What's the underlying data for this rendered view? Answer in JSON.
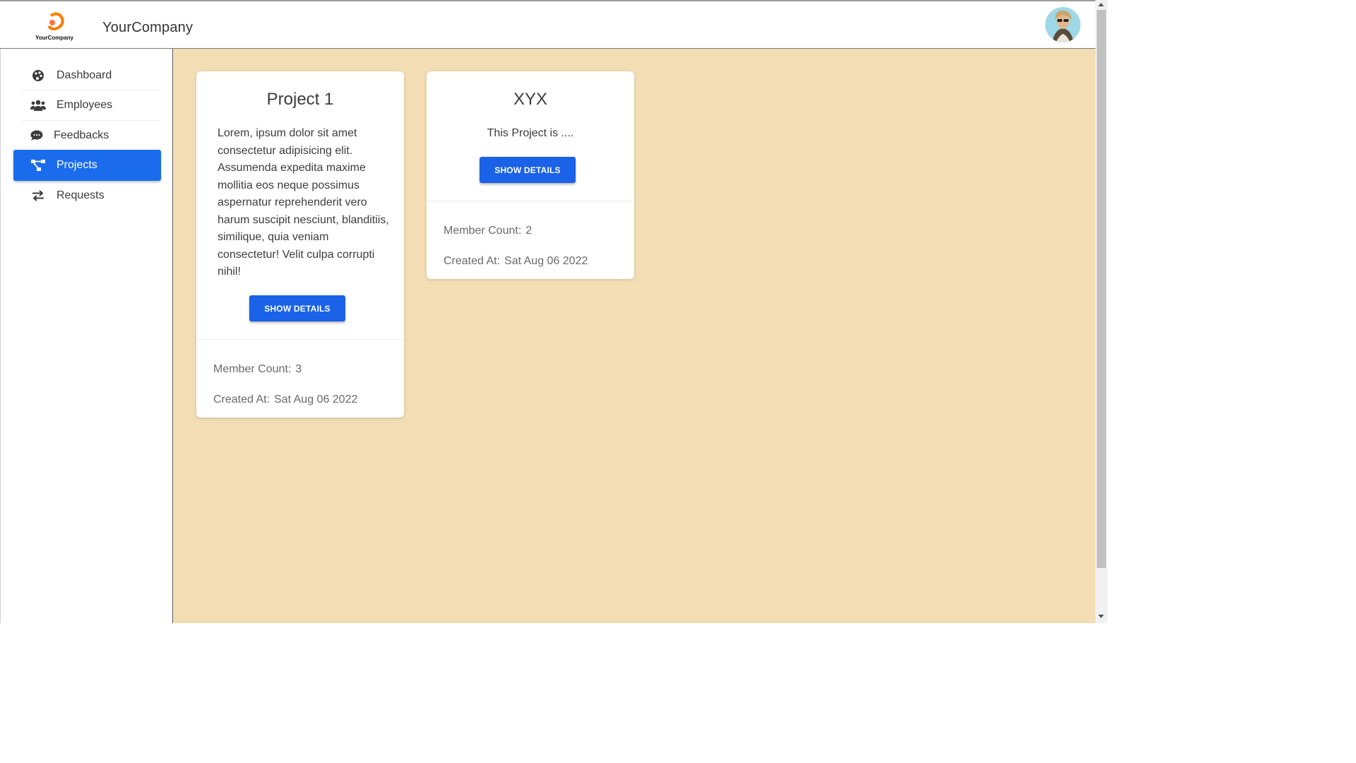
{
  "header": {
    "brand": "YourCompany",
    "logo_text": "YourCompany"
  },
  "sidebar": {
    "items": [
      {
        "label": "Dashboard",
        "icon": "palette-icon"
      },
      {
        "label": "Employees",
        "icon": "users-icon"
      },
      {
        "label": "Feedbacks",
        "icon": "comment-icon"
      },
      {
        "label": "Projects",
        "icon": "project-diagram-icon",
        "active": true
      },
      {
        "label": "Requests",
        "icon": "exchange-icon"
      }
    ]
  },
  "projects": [
    {
      "title": "Project 1",
      "description": "Lorem, ipsum dolor sit amet consectetur adipisicing elit. Assumenda expedita maxime mollitia eos neque possimus aspernatur reprehenderit vero harum suscipit nesciunt, blanditiis, similique, quia veniam consectetur! Velit culpa corrupti nihil!",
      "button": "SHOW DETAILS",
      "member_count_label": "Member Count:",
      "member_count": "3",
      "created_label": "Created At:",
      "created_at": "Sat Aug 06 2022"
    },
    {
      "title": "XYX",
      "description": "This Project is ....",
      "button": "SHOW DETAILS",
      "member_count_label": "Member Count:",
      "member_count": "2",
      "created_label": "Created At:",
      "created_at": "Sat Aug 06 2022"
    }
  ],
  "colors": {
    "accent": "#1a6ced",
    "background": "#f2ddb4"
  }
}
